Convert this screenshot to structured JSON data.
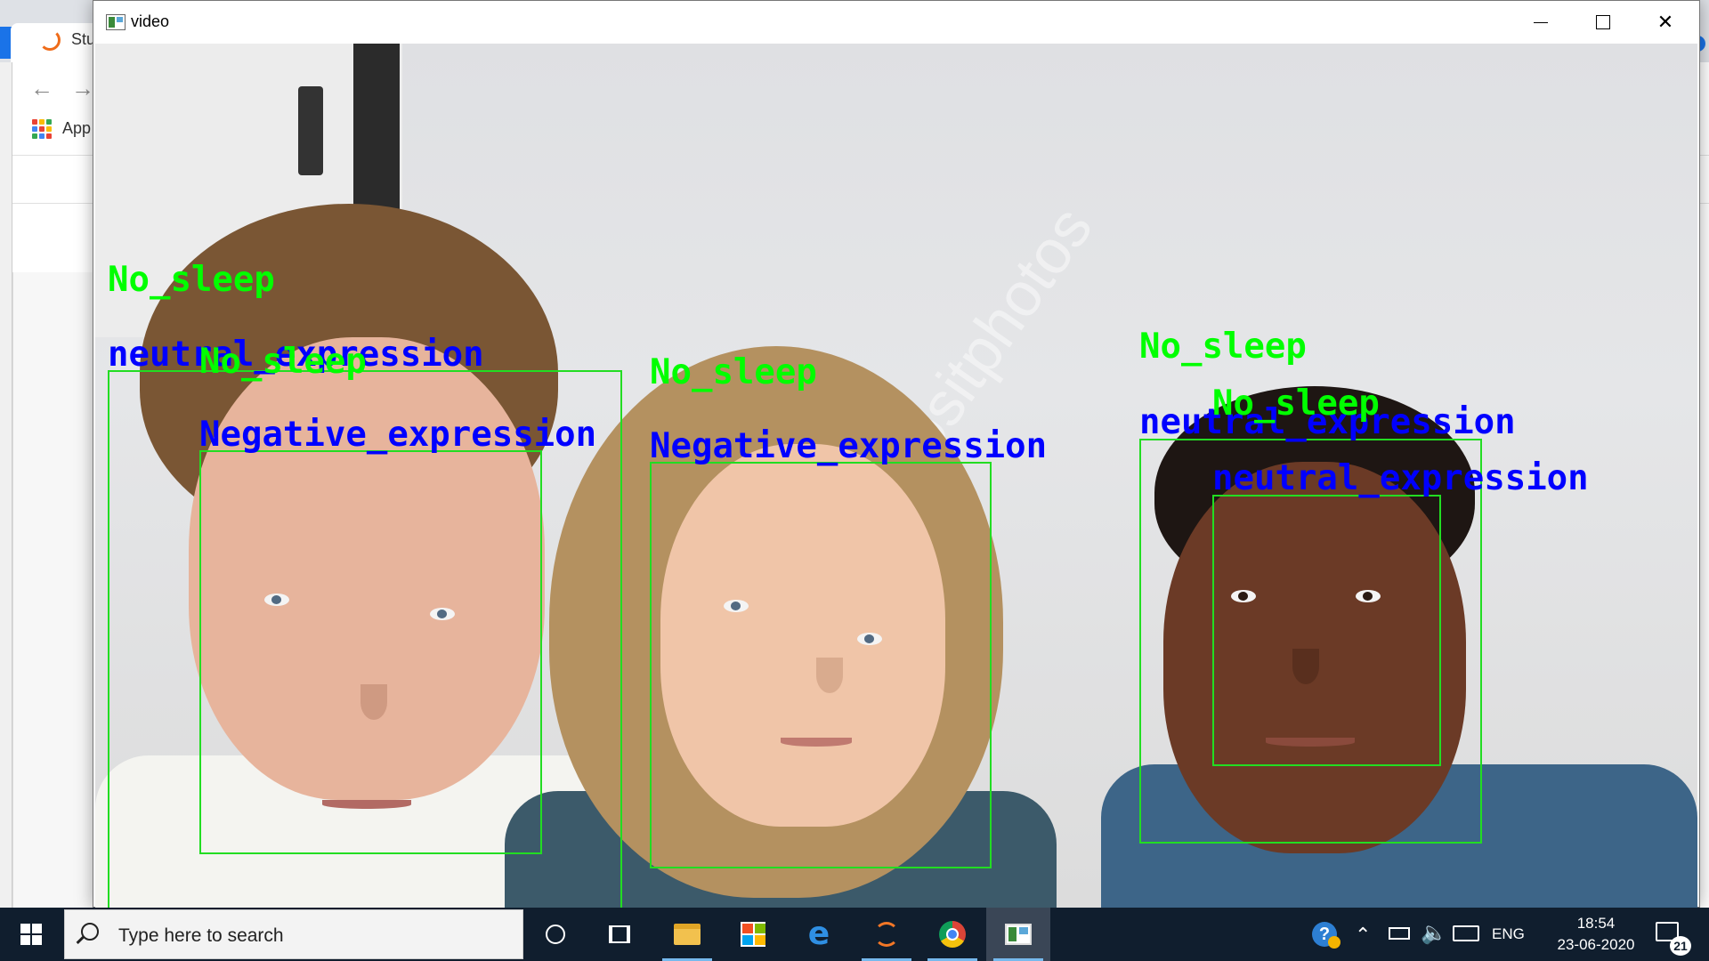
{
  "browser": {
    "tab_label": "Stu",
    "apps_label": "App",
    "back_icon": "arrow-left-icon",
    "forward_icon": "arrow-right-icon",
    "accent_color": "#1a73e8"
  },
  "video_window": {
    "title": "video",
    "buttons": {
      "minimize": "minimize-icon",
      "maximize": "maximize-icon",
      "close": "close-icon"
    },
    "watermark": "depositphotos",
    "detections": [
      {
        "person": "left man",
        "box_color": "#22dd22",
        "labels": [
          {
            "text": "No_sleep",
            "color": "#00ff00"
          },
          {
            "text": "neutral_expression",
            "color": "#0000ff"
          }
        ]
      },
      {
        "person": "left man (inner)",
        "box_color": "#22dd22",
        "labels": [
          {
            "text": "No_sleep",
            "color": "#00ff00"
          },
          {
            "text": "Negative_expression",
            "color": "#0000ff"
          }
        ]
      },
      {
        "person": "woman",
        "box_color": "#22dd22",
        "labels": [
          {
            "text": "No_sleep",
            "color": "#00ff00"
          },
          {
            "text": "Negative_expression",
            "color": "#0000ff"
          }
        ]
      },
      {
        "person": "right man",
        "box_color": "#22dd22",
        "labels": [
          {
            "text": "No_sleep",
            "color": "#00ff00"
          },
          {
            "text": "neutral_expression",
            "color": "#0000ff"
          }
        ]
      },
      {
        "person": "right man (inner)",
        "box_color": "#22dd22",
        "labels": [
          {
            "text": "No_sleep",
            "color": "#00ff00"
          },
          {
            "text": "neutral_expression",
            "color": "#0000ff"
          }
        ]
      }
    ]
  },
  "taskbar": {
    "search_placeholder": "Type here to search",
    "apps": [
      "cortana-icon",
      "task-view-icon",
      "file-explorer-icon",
      "microsoft-store-icon",
      "edge-icon",
      "jupyter-icon",
      "chrome-icon",
      "video-window-icon"
    ],
    "tray": {
      "language": "ENG",
      "time": "18:54",
      "date": "23-06-2020",
      "notification_count": "21"
    }
  }
}
